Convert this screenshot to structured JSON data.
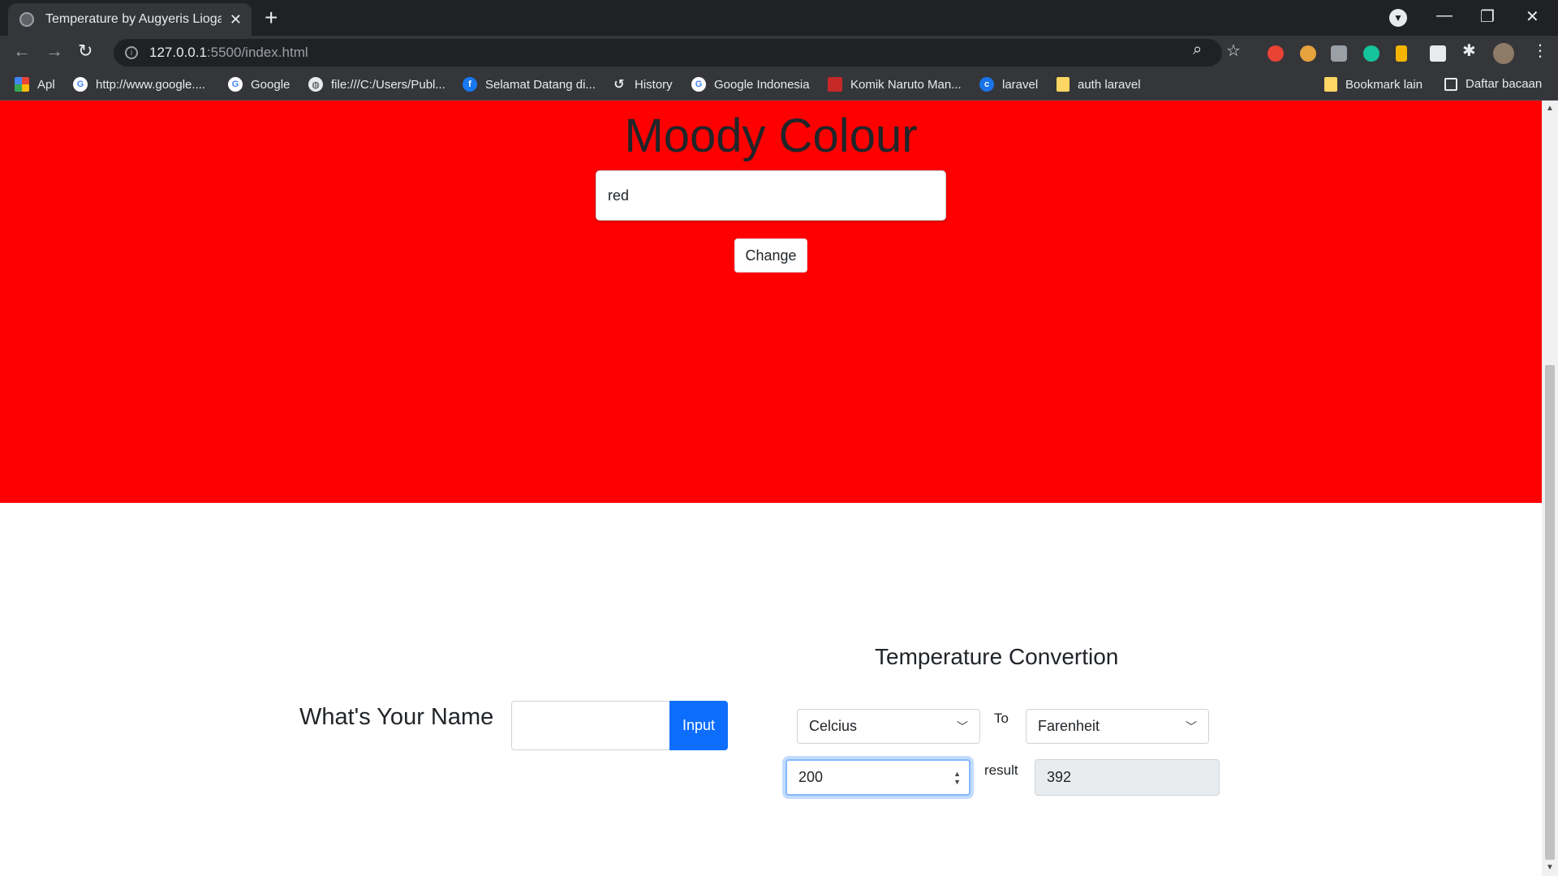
{
  "browser": {
    "tab_title": "Temperature by Augyeris Lioga S",
    "url_host": "127.0.0.1",
    "url_path": ":5500/index.html",
    "bookmarks": [
      {
        "label": "Apl",
        "icon": "apps-grid-icon",
        "color": "#ea4335"
      },
      {
        "label": "http://www.google....",
        "icon": "google-icon",
        "color": "#ffffff"
      },
      {
        "label": "Google",
        "icon": "google-icon",
        "color": "#ffffff"
      },
      {
        "label": "file:///C:/Users/Publ...",
        "icon": "globe-icon",
        "color": "#e8eaed"
      },
      {
        "label": "Selamat Datang di...",
        "icon": "facebook-icon",
        "color": "#1877f2"
      },
      {
        "label": "History",
        "icon": "history-icon",
        "color": "#e8eaed"
      },
      {
        "label": "Google Indonesia",
        "icon": "google-icon",
        "color": "#ffffff"
      },
      {
        "label": "Komik Naruto Man...",
        "icon": "manga-icon",
        "color": "#c62828"
      },
      {
        "label": "laravel",
        "icon": "laravel-icon",
        "color": "#1a73e8"
      },
      {
        "label": "auth laravel",
        "icon": "folder-icon",
        "color": "#fdd663"
      },
      {
        "label": "Bookmark lain",
        "icon": "folder-icon",
        "color": "#fdd663"
      },
      {
        "label": "Daftar bacaan",
        "icon": "reading-list-icon",
        "color": "#e8eaed"
      }
    ]
  },
  "mood": {
    "title": "Moody Colour",
    "input_value": "red",
    "button_label": "Change",
    "background_color": "#ff0000"
  },
  "name_form": {
    "label": "What's Your Name",
    "input_value": "",
    "button_label": "Input"
  },
  "temperature": {
    "title": "Temperature Convertion",
    "from_unit": "Celcius",
    "to_label": "To",
    "to_unit": "Farenheit",
    "input_value": "200",
    "result_label": "result",
    "result_value": "392"
  },
  "colors": {
    "accent": "#0d6efd",
    "chrome_dark": "#202124",
    "chrome_mid": "#35363a"
  }
}
